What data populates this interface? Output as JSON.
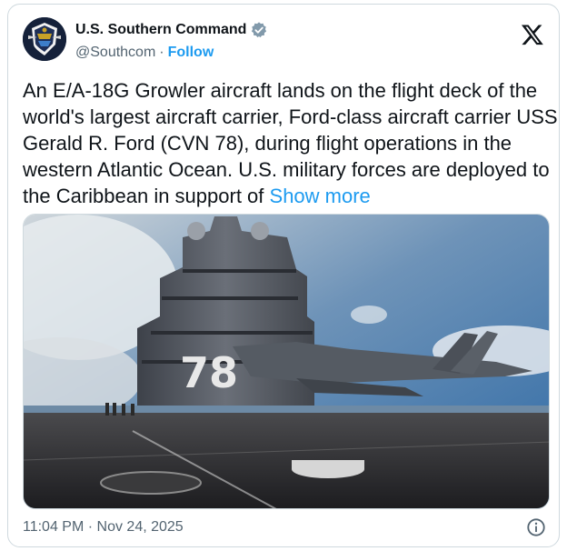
{
  "author": {
    "display_name": "U.S. Southern Command",
    "handle": "@Southcom",
    "separator": "·",
    "follow_label": "Follow",
    "verified_icon": "verified-badge-icon",
    "avatar_icon": "southcom-crest-icon"
  },
  "platform": {
    "logo_icon": "x-logo-icon"
  },
  "tweet": {
    "text": "An E/A-18G Growler aircraft lands on the flight deck of the world's largest aircraft carrier, Ford-class aircraft carrier USS Gerald R. Ford (CVN 78), during flight operations in the western Atlantic Ocean. U.S. military forces are deployed to the Caribbean in support of",
    "show_more_label": "Show more",
    "media": {
      "hull_number": "78"
    },
    "timestamp": "11:04 PM · Nov 24, 2025",
    "info_icon": "info-icon"
  },
  "colors": {
    "accent": "#1d9bf0",
    "text_primary": "#0f1419",
    "text_secondary": "#536471",
    "border": "#cfd9de"
  }
}
